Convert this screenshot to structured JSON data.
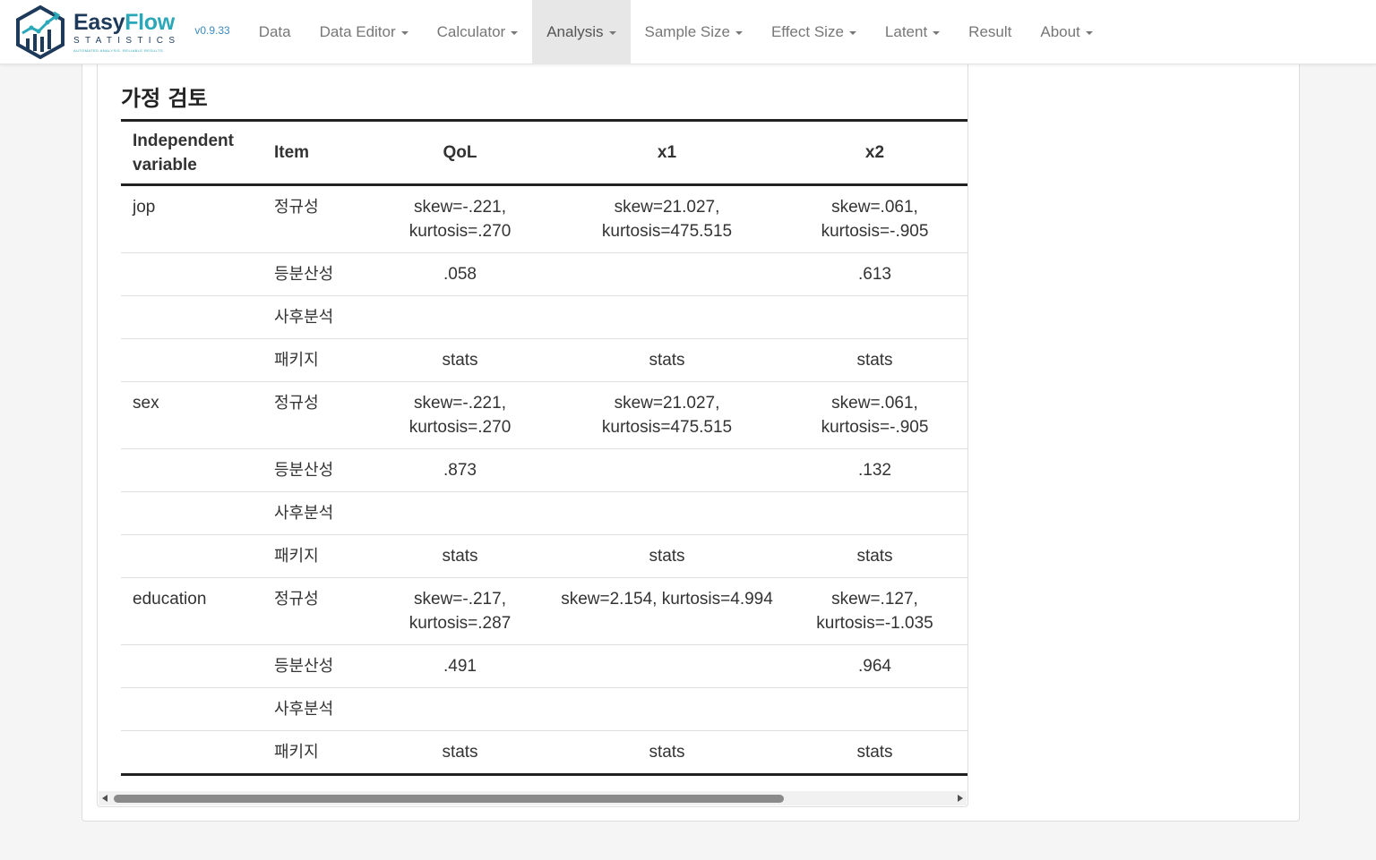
{
  "brand": {
    "name_part1": "Easy",
    "name_part2": "Flow",
    "subtitle": "STATISTICS",
    "tagline": "AUTOMATED ANALYSIS. RELIABLE RESULTS.",
    "version": "v0.9.33",
    "colors": {
      "dark": "#1e3a5a",
      "accent": "#2aa7b8"
    }
  },
  "nav": {
    "items": [
      {
        "label": "Data",
        "dropdown": false
      },
      {
        "label": "Data Editor",
        "dropdown": true
      },
      {
        "label": "Calculator",
        "dropdown": true
      },
      {
        "label": "Analysis",
        "dropdown": true,
        "active": true
      },
      {
        "label": "Sample Size",
        "dropdown": true
      },
      {
        "label": "Effect Size",
        "dropdown": true
      },
      {
        "label": "Latent",
        "dropdown": true
      },
      {
        "label": "Result",
        "dropdown": false
      },
      {
        "label": "About",
        "dropdown": true
      }
    ]
  },
  "section": {
    "title": "가정 검토"
  },
  "table": {
    "headers": [
      "Independent variable",
      "Item",
      "QoL",
      "x1",
      "x2"
    ],
    "rows": [
      {
        "var": "jop",
        "item": "정규성",
        "qol": "skew=-.221, kurtosis=.270",
        "x1": "skew=21.027, kurtosis=475.515",
        "x2": "skew=.061, kurtosis=-.905"
      },
      {
        "var": "",
        "item": "등분산성",
        "qol": ".058",
        "x1": "",
        "x2": ".613"
      },
      {
        "var": "",
        "item": "사후분석",
        "qol": "",
        "x1": "",
        "x2": ""
      },
      {
        "var": "",
        "item": "패키지",
        "qol": "stats",
        "x1": "stats",
        "x2": "stats"
      },
      {
        "var": "sex",
        "item": "정규성",
        "qol": "skew=-.221, kurtosis=.270",
        "x1": "skew=21.027, kurtosis=475.515",
        "x2": "skew=.061, kurtosis=-.905"
      },
      {
        "var": "",
        "item": "등분산성",
        "qol": ".873",
        "x1": "",
        "x2": ".132"
      },
      {
        "var": "",
        "item": "사후분석",
        "qol": "",
        "x1": "",
        "x2": ""
      },
      {
        "var": "",
        "item": "패키지",
        "qol": "stats",
        "x1": "stats",
        "x2": "stats"
      },
      {
        "var": "education",
        "item": "정규성",
        "qol": "skew=-.217, kurtosis=.287",
        "x1": "skew=2.154, kurtosis=4.994",
        "x2": "skew=.127, kurtosis=-1.035"
      },
      {
        "var": "",
        "item": "등분산성",
        "qol": ".491",
        "x1": "",
        "x2": ".964"
      },
      {
        "var": "",
        "item": "사후분석",
        "qol": "",
        "x1": "",
        "x2": ""
      },
      {
        "var": "",
        "item": "패키지",
        "qol": "stats",
        "x1": "stats",
        "x2": "stats"
      }
    ]
  }
}
